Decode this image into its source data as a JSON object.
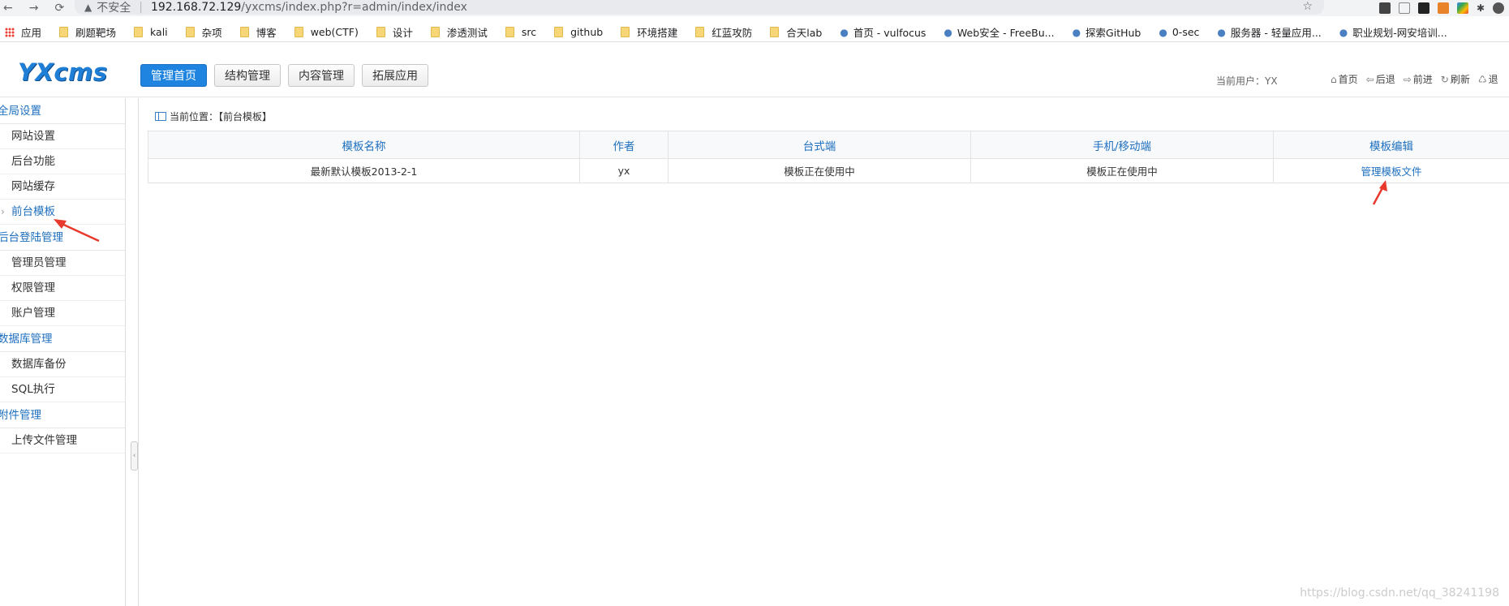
{
  "browser": {
    "insecure_label": "不安全",
    "url_host": "192.168.72.129",
    "url_path": "/yxcms/index.php?r=admin/index/index"
  },
  "bookmarks": [
    {
      "label": "应用",
      "type": "apps"
    },
    {
      "label": "刷题靶场",
      "type": "folder"
    },
    {
      "label": "kali",
      "type": "folder"
    },
    {
      "label": "杂项",
      "type": "folder"
    },
    {
      "label": "博客",
      "type": "folder"
    },
    {
      "label": "web(CTF)",
      "type": "folder"
    },
    {
      "label": "设计",
      "type": "folder"
    },
    {
      "label": "渗透测试",
      "type": "folder"
    },
    {
      "label": "src",
      "type": "folder"
    },
    {
      "label": "github",
      "type": "folder"
    },
    {
      "label": "环境搭建",
      "type": "folder"
    },
    {
      "label": "红蓝攻防",
      "type": "folder"
    },
    {
      "label": "合天lab",
      "type": "folder"
    },
    {
      "label": "首页 - vulfocus",
      "type": "site"
    },
    {
      "label": "Web安全 - FreeBu...",
      "type": "site"
    },
    {
      "label": "探索GitHub",
      "type": "site"
    },
    {
      "label": "0-sec",
      "type": "site"
    },
    {
      "label": "服务器 - 轻量应用...",
      "type": "site"
    },
    {
      "label": "职业规划-网安培训...",
      "type": "site"
    }
  ],
  "header": {
    "logo": "YXcms",
    "nav": [
      "管理首页",
      "结构管理",
      "内容管理",
      "拓展应用"
    ],
    "current_user": "当前用户：YX",
    "quick_links": [
      "首页",
      "后退",
      "前进",
      "刷新",
      "退"
    ]
  },
  "sidebar": {
    "sections": [
      {
        "title": "全局设置",
        "items": [
          "网站设置",
          "后台功能",
          "网站缓存",
          "前台模板"
        ]
      },
      {
        "title": "后台登陆管理",
        "items": [
          "管理员管理",
          "权限管理",
          "账户管理"
        ]
      },
      {
        "title": "数据库管理",
        "items": [
          "数据库备份",
          "SQL执行"
        ]
      },
      {
        "title": "附件管理",
        "items": [
          "上传文件管理"
        ]
      }
    ],
    "active_item": "前台模板"
  },
  "main": {
    "breadcrumb": "当前位置：【前台模板】",
    "table": {
      "headers": [
        "模板名称",
        "作者",
        "台式端",
        "手机/移动端",
        "模板编辑"
      ],
      "rows": [
        [
          "最新默认模板2013-2-1",
          "yx",
          "模板正在使用中",
          "模板正在使用中",
          "管理模板文件"
        ]
      ]
    }
  },
  "watermark": "https://blog.csdn.net/qq_38241198",
  "colors": {
    "accent": "#1e84e0",
    "in_use": "#e60012",
    "link": "#1e6fbf",
    "arrow": "#e8392d"
  }
}
